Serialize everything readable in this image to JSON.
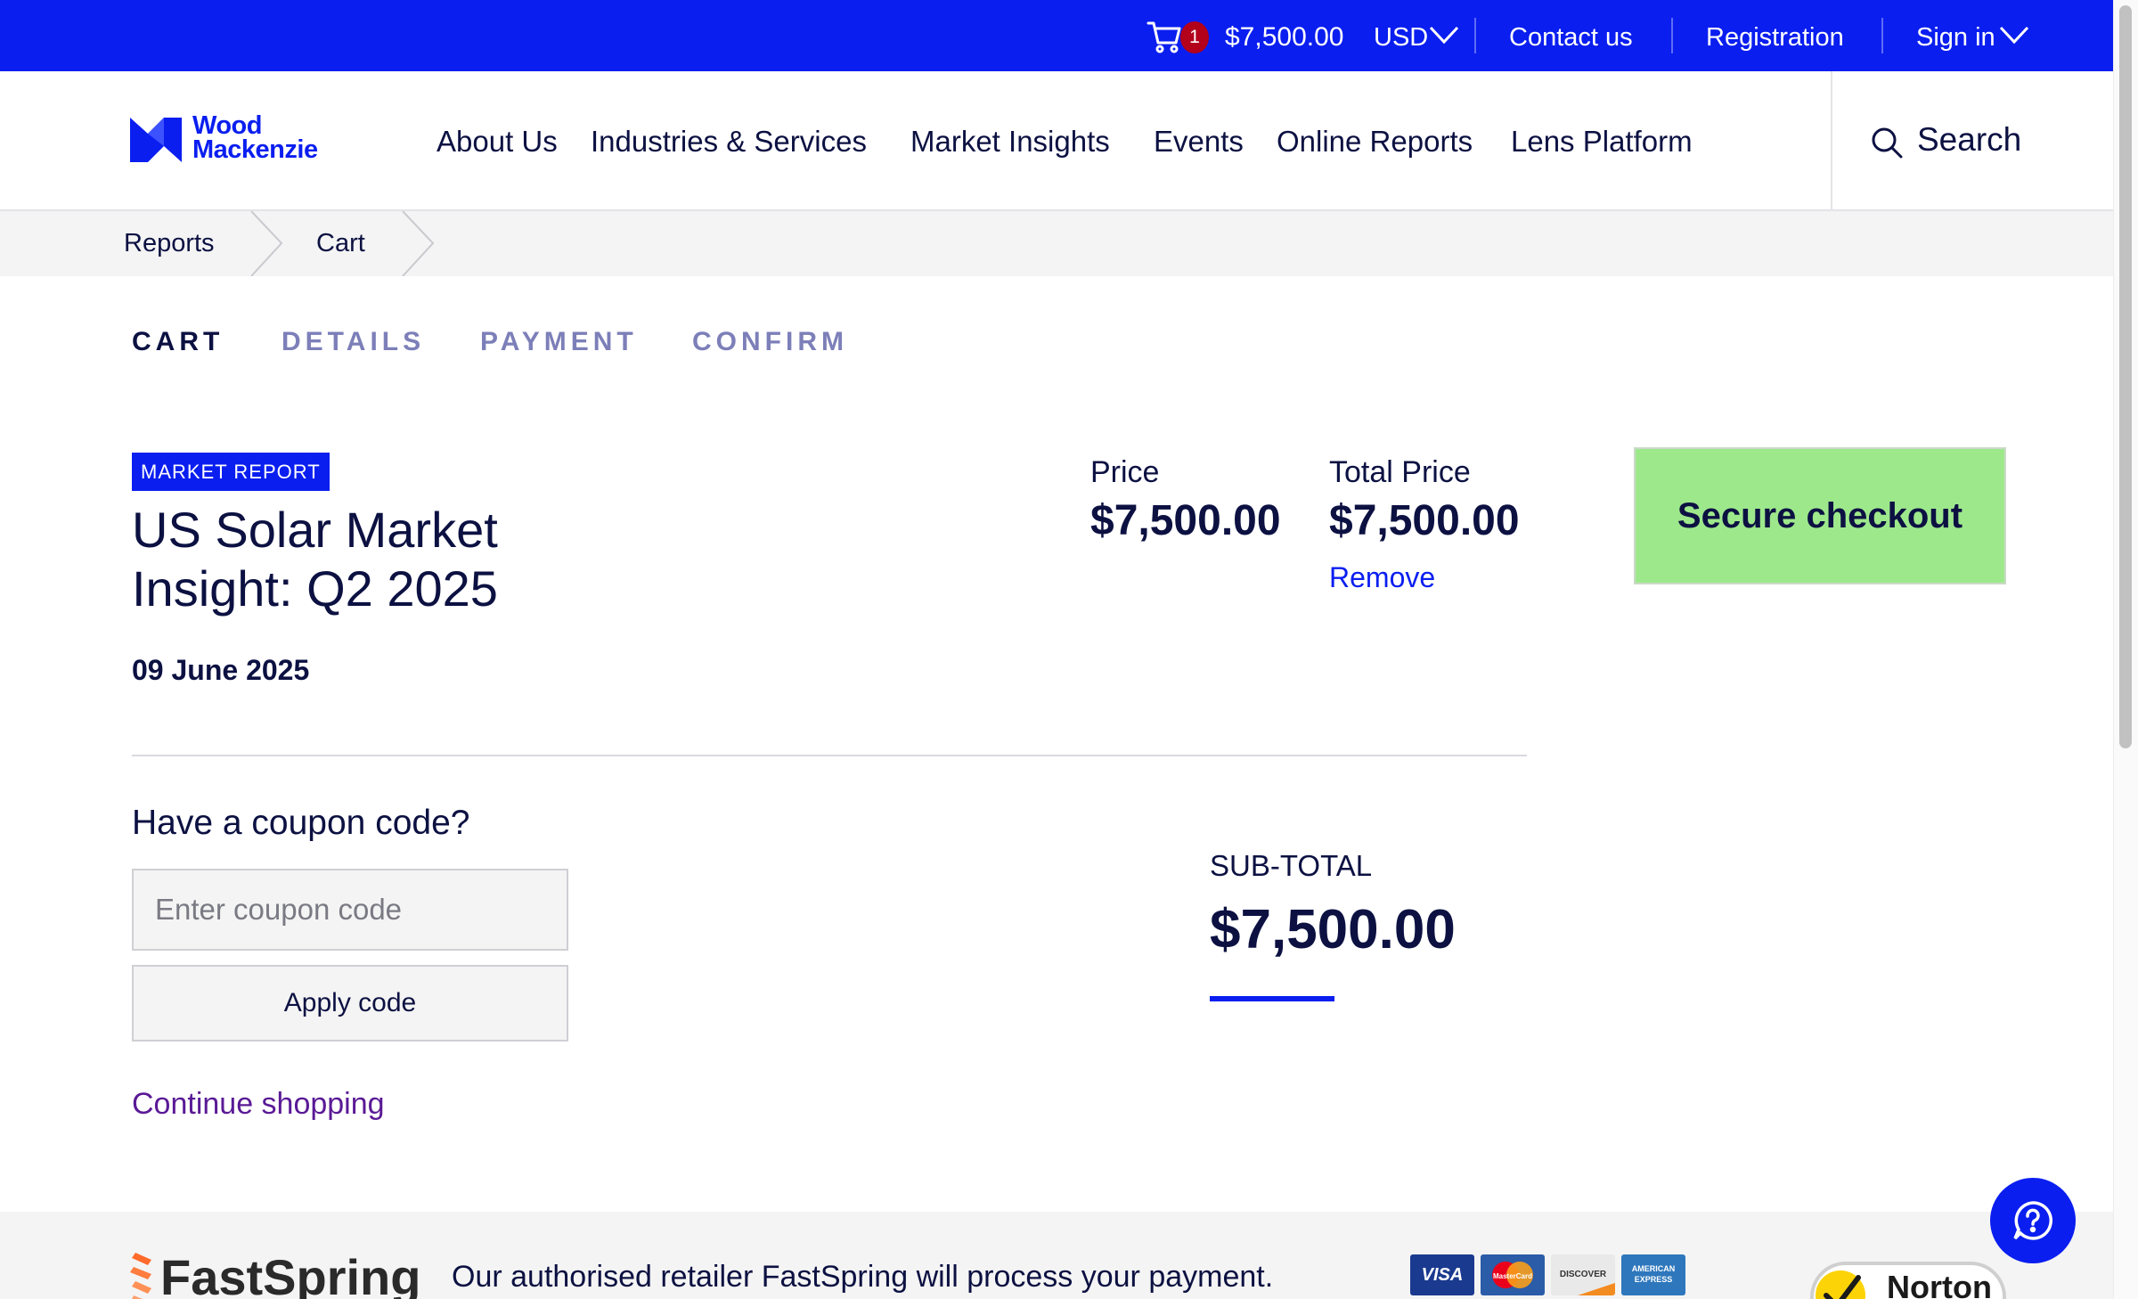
{
  "topbar": {
    "cart_count": "1",
    "cart_total": "$7,500.00",
    "currency": "USD",
    "contact": "Contact us",
    "registration": "Registration",
    "sign_in": "Sign in"
  },
  "brand": {
    "logo_line1": "Wood",
    "logo_line2": "Mackenzie",
    "accent_color": "#0a1ef0"
  },
  "nav": {
    "items": [
      "About Us",
      "Industries & Services",
      "Market Insights",
      "Events",
      "Online Reports",
      "Lens Platform"
    ],
    "search_label": "Search"
  },
  "breadcrumb": [
    "Reports",
    "Cart"
  ],
  "steps": [
    {
      "label": "CART",
      "active": true
    },
    {
      "label": "DETAILS",
      "active": false
    },
    {
      "label": "PAYMENT",
      "active": false
    },
    {
      "label": "CONFIRM",
      "active": false
    }
  ],
  "product": {
    "tag": "MARKET REPORT",
    "title": "US Solar Market Insight: Q2 2025",
    "date": "09 June 2025",
    "price_label": "Price",
    "price": "$7,500.00",
    "total_label": "Total Price",
    "total": "$7,500.00",
    "remove": "Remove"
  },
  "checkout": {
    "label": "Secure checkout",
    "color": "#9ee88c"
  },
  "coupon": {
    "heading": "Have a coupon code?",
    "placeholder": "Enter coupon code",
    "value": "",
    "apply": "Apply code",
    "continue": "Continue shopping"
  },
  "subtotal": {
    "label": "SUB-TOTAL",
    "value": "$7,500.00"
  },
  "footer": {
    "retailer_logo": "FastSpring",
    "text": "Our authorised retailer FastSpring will process your payment.",
    "cards": [
      {
        "name": "VISA",
        "icon": "visa-card-icon",
        "color": "#1a3a8f"
      },
      {
        "name": "MasterCard",
        "icon": "mastercard-icon",
        "color": "#2b5ca8"
      },
      {
        "name": "DISCOVER",
        "icon": "discover-card-icon",
        "color": "#e9e9e9"
      },
      {
        "name": "AMERICAN EXPRESS",
        "icon": "amex-card-icon",
        "color": "#2e77bc"
      }
    ],
    "security_badge": "Norton"
  },
  "icons": {
    "cart": "shopping-cart-icon",
    "search": "search-icon",
    "help": "help-chat-icon"
  }
}
